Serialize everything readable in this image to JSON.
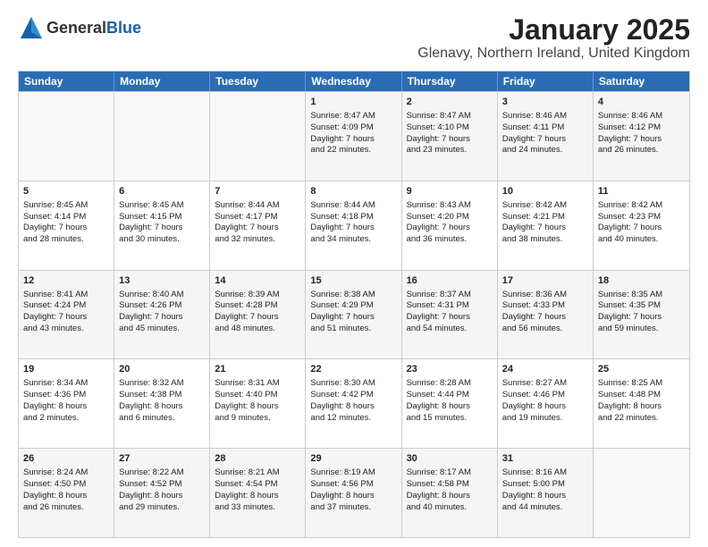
{
  "logo": {
    "general": "General",
    "blue": "Blue"
  },
  "title": "January 2025",
  "subtitle": "Glenavy, Northern Ireland, United Kingdom",
  "days": [
    "Sunday",
    "Monday",
    "Tuesday",
    "Wednesday",
    "Thursday",
    "Friday",
    "Saturday"
  ],
  "weeks": [
    [
      {
        "day": "",
        "content": ""
      },
      {
        "day": "",
        "content": ""
      },
      {
        "day": "",
        "content": ""
      },
      {
        "day": "1",
        "content": "Sunrise: 8:47 AM\nSunset: 4:09 PM\nDaylight: 7 hours\nand 22 minutes."
      },
      {
        "day": "2",
        "content": "Sunrise: 8:47 AM\nSunset: 4:10 PM\nDaylight: 7 hours\nand 23 minutes."
      },
      {
        "day": "3",
        "content": "Sunrise: 8:46 AM\nSunset: 4:11 PM\nDaylight: 7 hours\nand 24 minutes."
      },
      {
        "day": "4",
        "content": "Sunrise: 8:46 AM\nSunset: 4:12 PM\nDaylight: 7 hours\nand 26 minutes."
      }
    ],
    [
      {
        "day": "5",
        "content": "Sunrise: 8:45 AM\nSunset: 4:14 PM\nDaylight: 7 hours\nand 28 minutes."
      },
      {
        "day": "6",
        "content": "Sunrise: 8:45 AM\nSunset: 4:15 PM\nDaylight: 7 hours\nand 30 minutes."
      },
      {
        "day": "7",
        "content": "Sunrise: 8:44 AM\nSunset: 4:17 PM\nDaylight: 7 hours\nand 32 minutes."
      },
      {
        "day": "8",
        "content": "Sunrise: 8:44 AM\nSunset: 4:18 PM\nDaylight: 7 hours\nand 34 minutes."
      },
      {
        "day": "9",
        "content": "Sunrise: 8:43 AM\nSunset: 4:20 PM\nDaylight: 7 hours\nand 36 minutes."
      },
      {
        "day": "10",
        "content": "Sunrise: 8:42 AM\nSunset: 4:21 PM\nDaylight: 7 hours\nand 38 minutes."
      },
      {
        "day": "11",
        "content": "Sunrise: 8:42 AM\nSunset: 4:23 PM\nDaylight: 7 hours\nand 40 minutes."
      }
    ],
    [
      {
        "day": "12",
        "content": "Sunrise: 8:41 AM\nSunset: 4:24 PM\nDaylight: 7 hours\nand 43 minutes."
      },
      {
        "day": "13",
        "content": "Sunrise: 8:40 AM\nSunset: 4:26 PM\nDaylight: 7 hours\nand 45 minutes."
      },
      {
        "day": "14",
        "content": "Sunrise: 8:39 AM\nSunset: 4:28 PM\nDaylight: 7 hours\nand 48 minutes."
      },
      {
        "day": "15",
        "content": "Sunrise: 8:38 AM\nSunset: 4:29 PM\nDaylight: 7 hours\nand 51 minutes."
      },
      {
        "day": "16",
        "content": "Sunrise: 8:37 AM\nSunset: 4:31 PM\nDaylight: 7 hours\nand 54 minutes."
      },
      {
        "day": "17",
        "content": "Sunrise: 8:36 AM\nSunset: 4:33 PM\nDaylight: 7 hours\nand 56 minutes."
      },
      {
        "day": "18",
        "content": "Sunrise: 8:35 AM\nSunset: 4:35 PM\nDaylight: 7 hours\nand 59 minutes."
      }
    ],
    [
      {
        "day": "19",
        "content": "Sunrise: 8:34 AM\nSunset: 4:36 PM\nDaylight: 8 hours\nand 2 minutes."
      },
      {
        "day": "20",
        "content": "Sunrise: 8:32 AM\nSunset: 4:38 PM\nDaylight: 8 hours\nand 6 minutes."
      },
      {
        "day": "21",
        "content": "Sunrise: 8:31 AM\nSunset: 4:40 PM\nDaylight: 8 hours\nand 9 minutes."
      },
      {
        "day": "22",
        "content": "Sunrise: 8:30 AM\nSunset: 4:42 PM\nDaylight: 8 hours\nand 12 minutes."
      },
      {
        "day": "23",
        "content": "Sunrise: 8:28 AM\nSunset: 4:44 PM\nDaylight: 8 hours\nand 15 minutes."
      },
      {
        "day": "24",
        "content": "Sunrise: 8:27 AM\nSunset: 4:46 PM\nDaylight: 8 hours\nand 19 minutes."
      },
      {
        "day": "25",
        "content": "Sunrise: 8:25 AM\nSunset: 4:48 PM\nDaylight: 8 hours\nand 22 minutes."
      }
    ],
    [
      {
        "day": "26",
        "content": "Sunrise: 8:24 AM\nSunset: 4:50 PM\nDaylight: 8 hours\nand 26 minutes."
      },
      {
        "day": "27",
        "content": "Sunrise: 8:22 AM\nSunset: 4:52 PM\nDaylight: 8 hours\nand 29 minutes."
      },
      {
        "day": "28",
        "content": "Sunrise: 8:21 AM\nSunset: 4:54 PM\nDaylight: 8 hours\nand 33 minutes."
      },
      {
        "day": "29",
        "content": "Sunrise: 8:19 AM\nSunset: 4:56 PM\nDaylight: 8 hours\nand 37 minutes."
      },
      {
        "day": "30",
        "content": "Sunrise: 8:17 AM\nSunset: 4:58 PM\nDaylight: 8 hours\nand 40 minutes."
      },
      {
        "day": "31",
        "content": "Sunrise: 8:16 AM\nSunset: 5:00 PM\nDaylight: 8 hours\nand 44 minutes."
      },
      {
        "day": "",
        "content": ""
      }
    ]
  ]
}
